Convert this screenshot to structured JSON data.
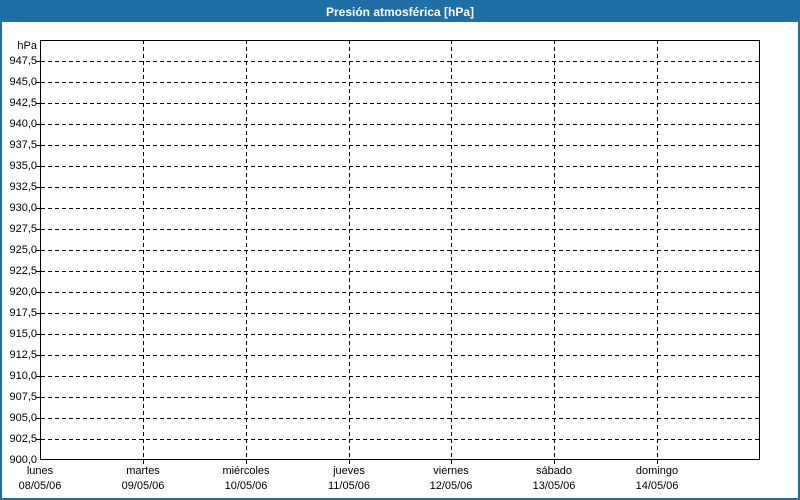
{
  "header": {
    "title": "Presión atmosférica [hPa]"
  },
  "chart_data": {
    "type": "line",
    "title": "Presión atmosférica [hPa]",
    "ylabel": "hPa",
    "xlabel": "",
    "ylim": [
      900,
      950
    ],
    "ytick_step": 2.5,
    "grid": "dashed",
    "legend": "none",
    "series": [],
    "yticks": [
      {
        "value": 947.5,
        "label": "947,5"
      },
      {
        "value": 945.0,
        "label": "945,0"
      },
      {
        "value": 942.5,
        "label": "942,5"
      },
      {
        "value": 940.0,
        "label": "940,0"
      },
      {
        "value": 937.5,
        "label": "937,5"
      },
      {
        "value": 935.0,
        "label": "935,0"
      },
      {
        "value": 932.5,
        "label": "932,5"
      },
      {
        "value": 930.0,
        "label": "930,0"
      },
      {
        "value": 927.5,
        "label": "927,5"
      },
      {
        "value": 925.0,
        "label": "925,0"
      },
      {
        "value": 922.5,
        "label": "922,5"
      },
      {
        "value": 920.0,
        "label": "920,0"
      },
      {
        "value": 917.5,
        "label": "917,5"
      },
      {
        "value": 915.0,
        "label": "915,0"
      },
      {
        "value": 912.5,
        "label": "912,5"
      },
      {
        "value": 910.0,
        "label": "910,0"
      },
      {
        "value": 907.5,
        "label": "907,5"
      },
      {
        "value": 905.0,
        "label": "905,0"
      },
      {
        "value": 902.5,
        "label": "902,5"
      },
      {
        "value": 900.0,
        "label": "900,0"
      }
    ],
    "x_categories": [
      {
        "day": "lunes",
        "date": "08/05/06"
      },
      {
        "day": "martes",
        "date": "09/05/06"
      },
      {
        "day": "miércoles",
        "date": "10/05/06"
      },
      {
        "day": "jueves",
        "date": "11/05/06"
      },
      {
        "day": "viernes",
        "date": "12/05/06"
      },
      {
        "day": "sábado",
        "date": "13/05/06"
      },
      {
        "day": "domingo",
        "date": "14/05/06"
      }
    ]
  },
  "colors": {
    "header_bg": "#1D6FA5",
    "header_text": "#FFFFFF",
    "panel_border": "#1D6FA5",
    "background": "#FFFFFF",
    "plot_background": "#FFFFFF",
    "grid_line": "#000000",
    "axis_line": "#000000",
    "label_text": "#000000"
  }
}
